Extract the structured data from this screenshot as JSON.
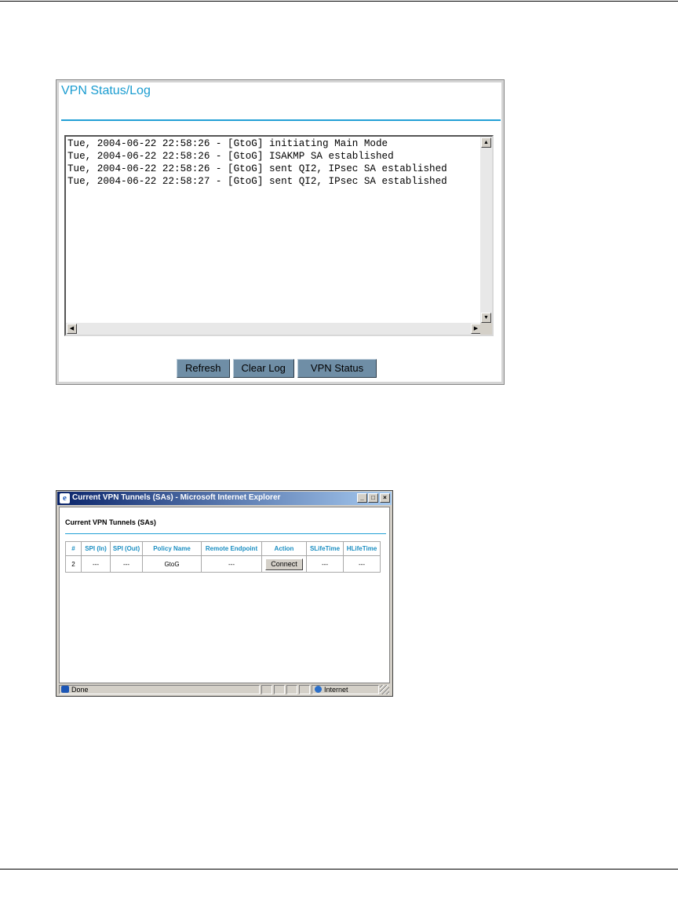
{
  "vpn_log_panel": {
    "title": "VPN Status/Log",
    "log_lines": [
      "Tue, 2004-06-22 22:58:26 - [GtoG] initiating Main Mode",
      "Tue, 2004-06-22 22:58:26 - [GtoG] ISAKMP SA established",
      "Tue, 2004-06-22 22:58:26 - [GtoG] sent QI2, IPsec SA established",
      "Tue, 2004-06-22 22:58:27 - [GtoG] sent QI2, IPsec SA established"
    ],
    "buttons": {
      "refresh": "Refresh",
      "clear_log": "Clear Log",
      "vpn_status": "VPN Status"
    }
  },
  "ie_window": {
    "title": "Current VPN Tunnels (SAs) - Microsoft Internet Explorer",
    "page_title": "Current VPN Tunnels (SAs)",
    "table": {
      "headers": [
        "#",
        "SPI (In)",
        "SPI (Out)",
        "Policy Name",
        "Remote Endpoint",
        "Action",
        "SLifeTime",
        "HLifeTime"
      ],
      "row": {
        "num": "2",
        "spi_in": "---",
        "spi_out": "---",
        "policy": "GtoG",
        "remote": "---",
        "action": "Connect",
        "slife": "---",
        "hlife": "---"
      }
    },
    "status": {
      "left": "Done",
      "zone": "Internet"
    }
  }
}
